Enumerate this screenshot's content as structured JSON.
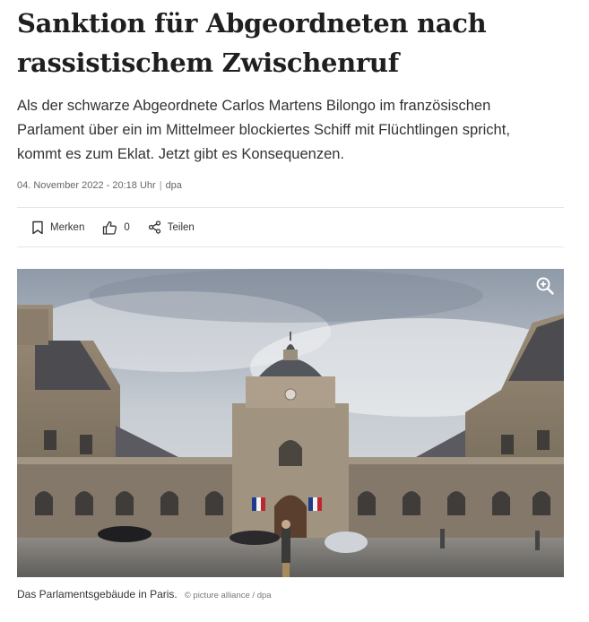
{
  "article": {
    "headline_line1": "Sanktion für Abgeordneten nach",
    "headline_line2": "rassistischem Zwischenruf",
    "teaser": "Als der schwarze Abgeordnete Carlos Martens Bilongo im französischen Parlament über ein im Mittelmeer blockiertes Schiff mit Flüchtlingen spricht, kommt es zum Eklat. Jetzt gibt es Konsequenzen.",
    "date": "04. November 2022 - 20:18 Uhr",
    "separator": "|",
    "source": "dpa"
  },
  "actions": {
    "bookmark_label": "Merken",
    "like_count": "0",
    "share_label": "Teilen"
  },
  "image": {
    "caption": "Das Parlamentsgebäude in Paris.",
    "credit": "© picture alliance / dpa",
    "zoom_icon": "zoom-in-icon"
  }
}
